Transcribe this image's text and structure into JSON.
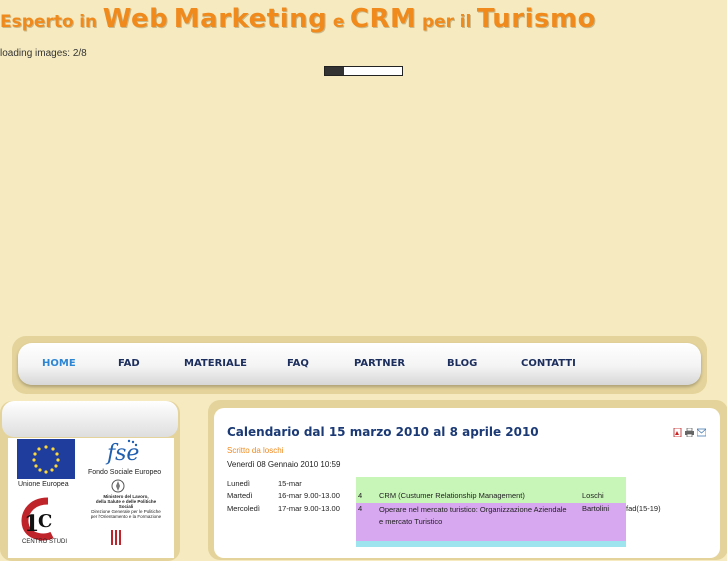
{
  "header": {
    "title_parts": [
      "Esperto",
      "in",
      "Web",
      "Marketing",
      "e",
      "CRM",
      "per",
      "il",
      "Turismo"
    ]
  },
  "loading": {
    "text": "loading images: 2/8",
    "progress": 0.25
  },
  "nav": {
    "items": [
      "HOME",
      "FAD",
      "MATERIALE",
      "FAQ",
      "PARTNER",
      "BLOG",
      "CONTATTI"
    ],
    "active": "HOME"
  },
  "sidebar": {
    "logos": {
      "eu": "Unione Europea",
      "fse": "Fondo Sociale Europeo",
      "ministero_line1": "Ministero del Lavoro,",
      "ministero_line2": "della Salute e delle Politiche Sociali",
      "ministero_line3": "Direzione Generale per le Politiche",
      "ministero_line4": "per l'Orientamento e la Formazione",
      "centro": "CENTRO STUDI"
    }
  },
  "article": {
    "title": "Calendario dal 15 marzo 2010 al 8 aprile 2010",
    "author": "Scritto da loschi",
    "date": "Venerdì 08 Gennaio 2010 10:59",
    "icons": [
      "pdf-icon",
      "print-icon",
      "email-icon"
    ],
    "rows": [
      {
        "day": "Lunedì",
        "date": "15-mar",
        "time": "",
        "hours": "",
        "module": "",
        "teacher": "",
        "extra": ""
      },
      {
        "day": "Martedì",
        "date": "16-mar",
        "time": "9.00-13.00",
        "hours": "4",
        "module": "CRM (Custumer Relationship Management)",
        "teacher": "Loschi",
        "extra": ""
      },
      {
        "day": "Mercoledì",
        "date": "17-mar",
        "time": "9.00-13.00",
        "hours": "4",
        "module": "Operare nel mercato turistico: Organizzazione Aziendale",
        "module2": "e mercato Turistico",
        "teacher": "Bartolini",
        "extra": "fad(15-19)"
      }
    ]
  },
  "colors": {
    "background": "#f6ebc0",
    "title_orange": "#f08a1c",
    "nav_text": "#1c2e5e",
    "nav_active": "#2d86d4",
    "article_title": "#1b3a75",
    "row_green": "#c8f5b8",
    "row_purple": "#d7a7f0",
    "row_cyan": "#9de4ee"
  }
}
